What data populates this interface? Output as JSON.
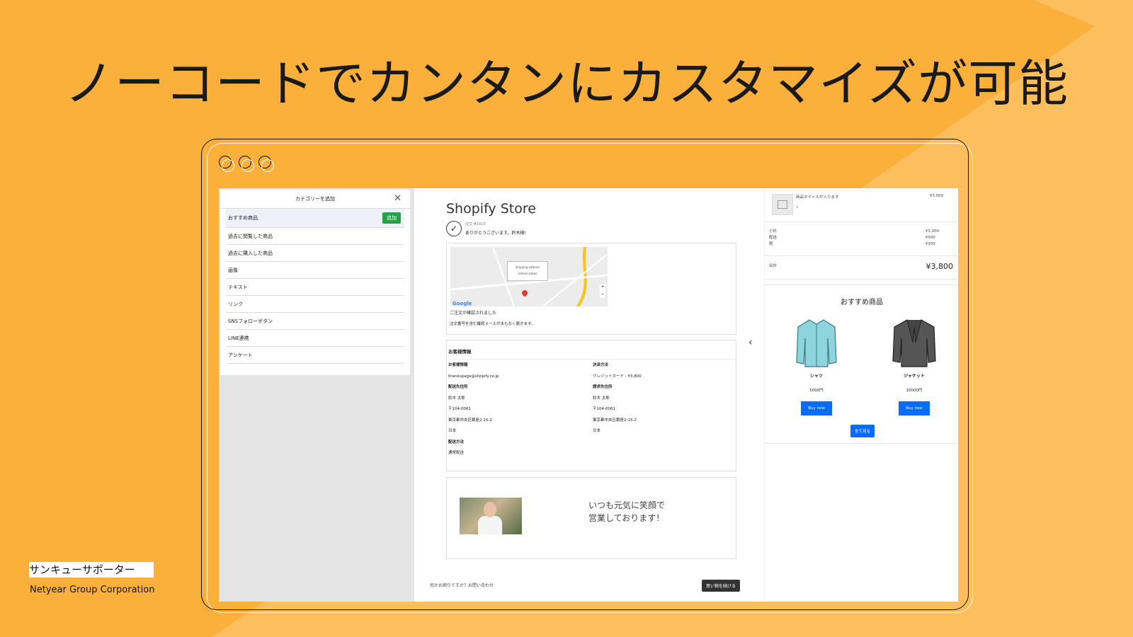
{
  "headline": "ノーコードでカンタンにカスタマイズが可能",
  "left_panel": {
    "title": "カテゴリーを追加",
    "add_label": "追加",
    "items": [
      "おすすめ商品",
      "過去に閲覧した商品",
      "過去に購入した商品",
      "画像",
      "テキスト",
      "リンク",
      "SNSフォローボタン",
      "LINE連携",
      "アンケート"
    ]
  },
  "order": {
    "store_title": "Shopify Store",
    "order_no": "注文 #1010",
    "thanks": "ありがとうございます。鈴木様!",
    "map": {
      "tip_line1": "Shipping address",
      "tip_line2": "United states",
      "brand": "Google"
    },
    "confirmed": "ご注文が確認されました",
    "confirmed_sub": "注文番号を含む確認メールがまもなく届きます。",
    "customer_header": "お客様情報",
    "left_col": {
      "h1": "お客様情報",
      "email": "thankspage@shopify.co.jp",
      "h2": "配送先住所",
      "name": "鈴木 太郎",
      "zip": "〒104-0061",
      "addr": "東京都中央区銀座2-15-2",
      "country": "日本",
      "h3": "配送方法",
      "ship": "通常配送"
    },
    "right_col": {
      "h1": "決済方法",
      "pay": "クレジットカード - ¥3,800",
      "h2": "請求先住所",
      "name": "鈴木 太郎",
      "zip": "〒104-0061",
      "addr": "東京都中央区銀座2-15-2",
      "country": "日本"
    },
    "promo_line1": "いつも元気に笑顔で",
    "promo_line2": "営業しております！",
    "footer_question": "何かお困りですか？お問い合わせ",
    "continue_label": "買い物を続ける"
  },
  "summary": {
    "product_title": "商品タイトルが入ります",
    "product_price": "¥3,000",
    "subtotal_label": "小計",
    "subtotal": "¥3,000",
    "shipping_label": "配送",
    "shipping": "¥500",
    "tax_label": "税",
    "tax": "¥300",
    "total_label": "合計",
    "total": "¥3,800"
  },
  "recommend": {
    "title": "おすすめ商品",
    "products": [
      {
        "name": "シャツ",
        "price": "5000円",
        "button": "Buy now",
        "color": "#8fd3dc"
      },
      {
        "name": "ジャケット",
        "price": "10000円",
        "button": "Buy now",
        "color": "#555555"
      }
    ],
    "see_all": "全て見る"
  },
  "footer": {
    "brand": "サンキューサポーター",
    "corp": "Netyear Group Corporation"
  }
}
